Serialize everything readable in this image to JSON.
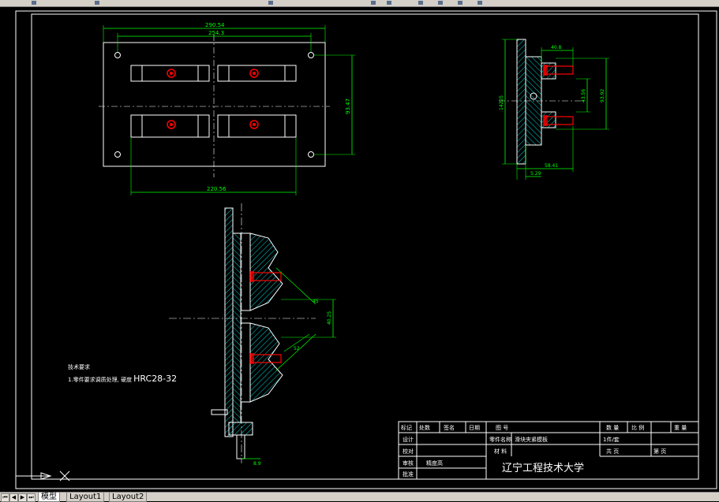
{
  "colors": {
    "background": "#000000",
    "line_white": "#ffffff",
    "dimension_green": "#00ff00",
    "hatch_cyan": "#00ffff",
    "part_red": "#ff0000",
    "center_line_white": "#ffffff"
  },
  "toolbar": {
    "icons": [
      "toolbar-button-icon"
    ]
  },
  "top_view": {
    "dim_overall_width": "290.54",
    "dim_inner_width": "254.3",
    "dim_bottom_width": "220.56",
    "dim_height": "93.47"
  },
  "side_view": {
    "dim_top": "40.8",
    "dim_left_height": "14225",
    "dim_inner_height": "43.56",
    "dim_right_height": "93.92",
    "dim_bottom_width": "58.41",
    "dim_offset": "5.29"
  },
  "section_view": {
    "dim_mid": "40.25",
    "dim_angle": "45",
    "dim_lower": "52",
    "dim_bottom": "8.9"
  },
  "tech_notes": {
    "title": "技术要求",
    "line1_prefix": "1.零件要求调质处理, 硬度",
    "line1_value": "HRC28-32"
  },
  "title_block": {
    "header": [
      "标记",
      "处数",
      "签名",
      "日期",
      "图 号",
      "数 量",
      "比 例",
      "重 量"
    ],
    "row2_labels": [
      "设计",
      "零件名称",
      "1件/套"
    ],
    "part_name": "滑块夹紧模板",
    "row3_labels": [
      "校对",
      "材 料",
      "共 页",
      "第 页"
    ],
    "row4_labels": [
      "审核"
    ],
    "row4_value": "精度高",
    "row5_labels": [
      "批准"
    ],
    "school": "辽宁工程技术大学"
  },
  "tabs": {
    "model": "模型",
    "layout1": "Layout1",
    "layout2": "Layout2"
  },
  "nav": {
    "first": "⏮",
    "prev": "◀",
    "next": "▶",
    "last": "⏭"
  }
}
